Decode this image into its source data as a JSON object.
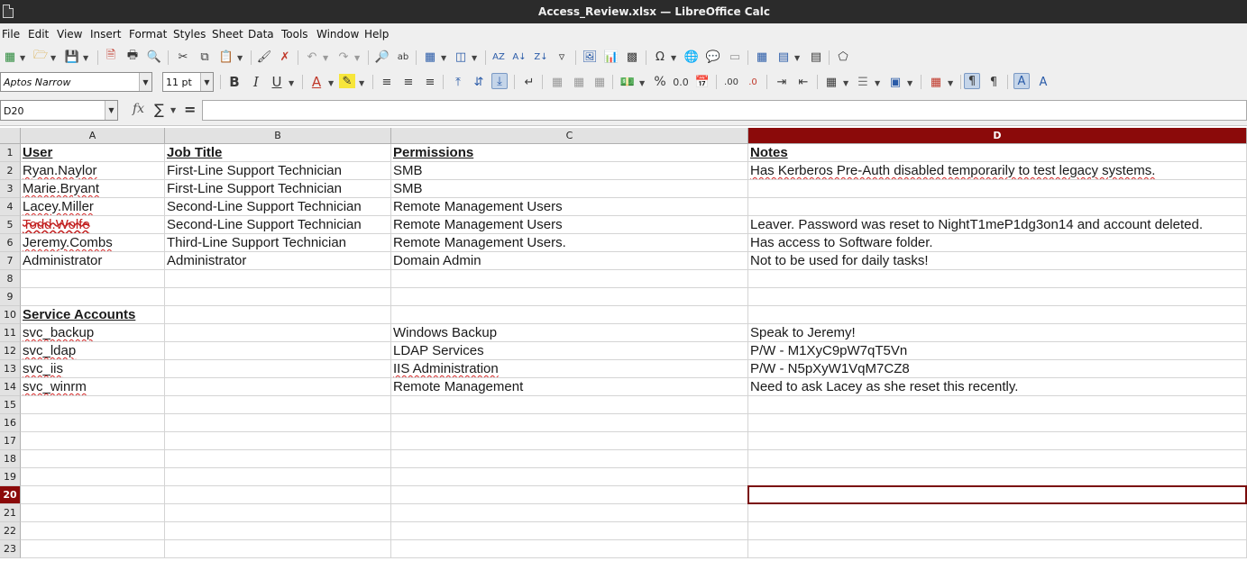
{
  "window": {
    "title": "Access_Review.xlsx — LibreOffice Calc"
  },
  "menu": [
    "File",
    "Edit",
    "View",
    "Insert",
    "Format",
    "Styles",
    "Sheet",
    "Data",
    "Tools",
    "Window",
    "Help"
  ],
  "formatting": {
    "font_name": "Aptos Narrow",
    "font_size": "11 pt"
  },
  "formula_bar": {
    "name_box": "D20",
    "fx": "fx",
    "sigma": "∑",
    "equals": "=",
    "content": ""
  },
  "columns": [
    "A",
    "B",
    "C",
    "D"
  ],
  "rows": [
    "1",
    "2",
    "3",
    "4",
    "5",
    "6",
    "7",
    "8",
    "9",
    "10",
    "11",
    "12",
    "13",
    "14",
    "15",
    "16",
    "17",
    "18",
    "19",
    "20",
    "21",
    "22",
    "23"
  ],
  "selected_cell": "D20",
  "cells": {
    "A1": "User",
    "B1": "Job Title",
    "C1": "Permissions",
    "D1": "Notes",
    "A2": "Ryan.Naylor",
    "B2": "First-Line Support Technician",
    "C2": "SMB",
    "D2": "Has Kerberos Pre-Auth disabled temporarily to test legacy systems.",
    "A3": "Marie.Bryant",
    "B3": "First-Line Support Technician",
    "C3": "SMB",
    "A4": "Lacey.Miller",
    "B4": "Second-Line Support Technician",
    "C4": "Remote Management Users",
    "A5": "Todd.Wolfe",
    "B5": "Second-Line Support Technician",
    "C5": "Remote Management Users",
    "D5": "Leaver. Password was reset to NightT1meP1dg3on14 and account deleted.",
    "A6": "Jeremy.Combs",
    "B6": "Third-Line Support Technician",
    "C6": "Remote Management Users.",
    "D6": "Has access to Software folder.",
    "A7": "Administrator",
    "B7": "Administrator",
    "C7": "Domain Admin",
    "D7": "Not to be used for daily tasks!",
    "A10": "Service Accounts",
    "A11": "svc_backup",
    "C11": "Windows Backup",
    "D11": "Speak to Jeremy!",
    "A12": "svc_ldap",
    "C12": "LDAP Services",
    "D12": "P/W - M1XyC9pW7qT5Vn",
    "A13": "svc_iis",
    "C13": "IIS Administration",
    "D13": "P/W - N5pXyW1VqM7CZ8",
    "A14": "svc_winrm",
    "C14": "Remote Management",
    "D14": "Need to ask Lacey as she reset this recently."
  },
  "colors": {
    "title_bar": "#2b2b2b",
    "ui_background": "#efefef",
    "selection_header": "#8b0a0a",
    "cursor_border": "#7a0b0b",
    "strike_text": "#c21f1f"
  }
}
